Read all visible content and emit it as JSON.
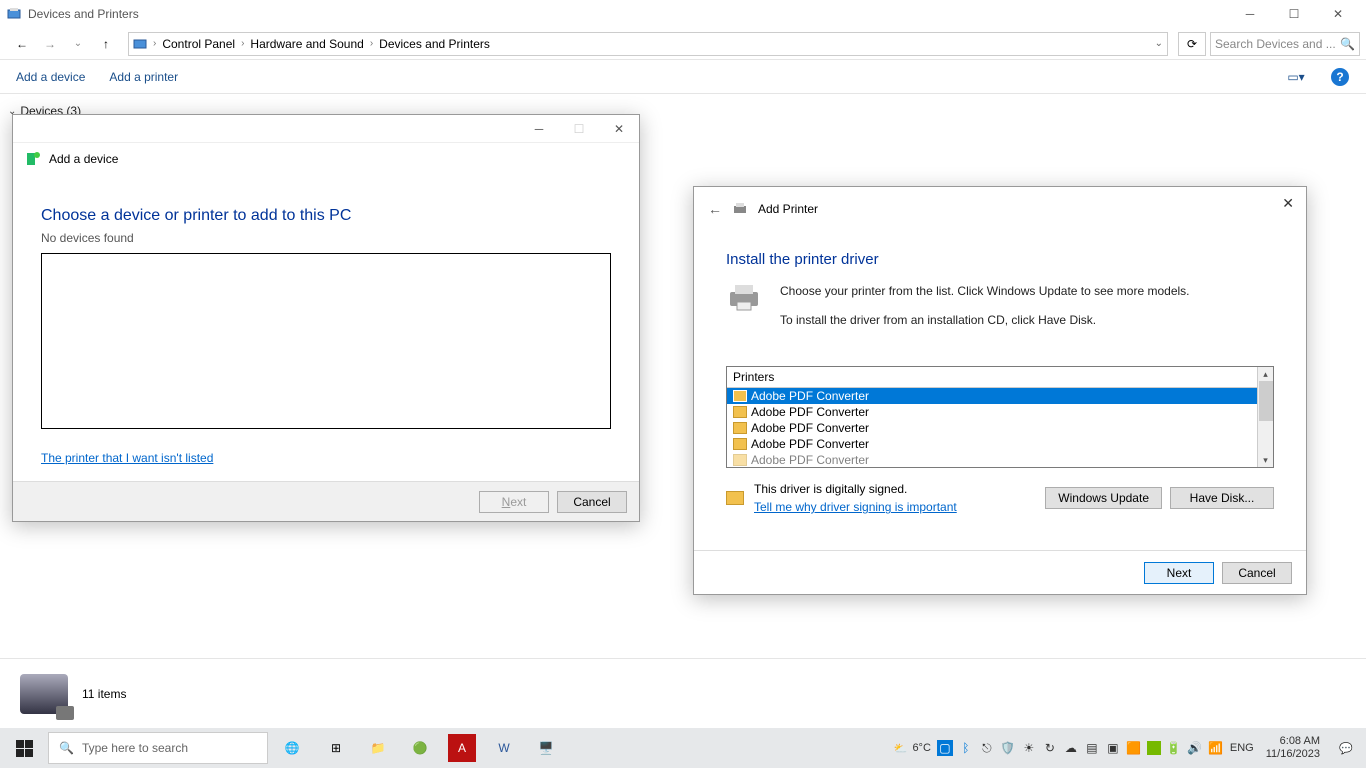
{
  "window": {
    "title": "Devices and Printers"
  },
  "breadcrumbs": {
    "items": [
      "Control Panel",
      "Hardware and Sound",
      "Devices and Printers"
    ]
  },
  "search": {
    "placeholder": "Search Devices and ..."
  },
  "toolbar": {
    "add_device": "Add a device",
    "add_printer": "Add a printer"
  },
  "section": {
    "title": "Devices (3)"
  },
  "add_device_dialog": {
    "label": "Add a device",
    "heading": "Choose a device or printer to add to this PC",
    "subtext": "No devices found",
    "link": "The printer that I want isn't listed",
    "next": "Next",
    "cancel": "Cancel"
  },
  "add_printer_dialog": {
    "label": "Add Printer",
    "heading": "Install the printer driver",
    "line1": "Choose your printer from the list. Click Windows Update to see more models.",
    "line2": "To install the driver from an installation CD, click Have Disk.",
    "col_header": "Printers",
    "items": [
      "Adobe PDF Converter",
      "Adobe PDF Converter",
      "Adobe PDF Converter",
      "Adobe PDF Converter",
      "Adobe PDF Converter"
    ],
    "signed": "This driver is digitally signed.",
    "signing_link": "Tell me why driver signing is important",
    "windows_update": "Windows Update",
    "have_disk": "Have Disk...",
    "next": "Next",
    "cancel": "Cancel"
  },
  "statusbar": {
    "items_text": "11 items"
  },
  "taskbar": {
    "search_placeholder": "Type here to search",
    "weather": "6°C",
    "lang": "ENG",
    "time": "6:08 AM",
    "date": "11/16/2023"
  }
}
